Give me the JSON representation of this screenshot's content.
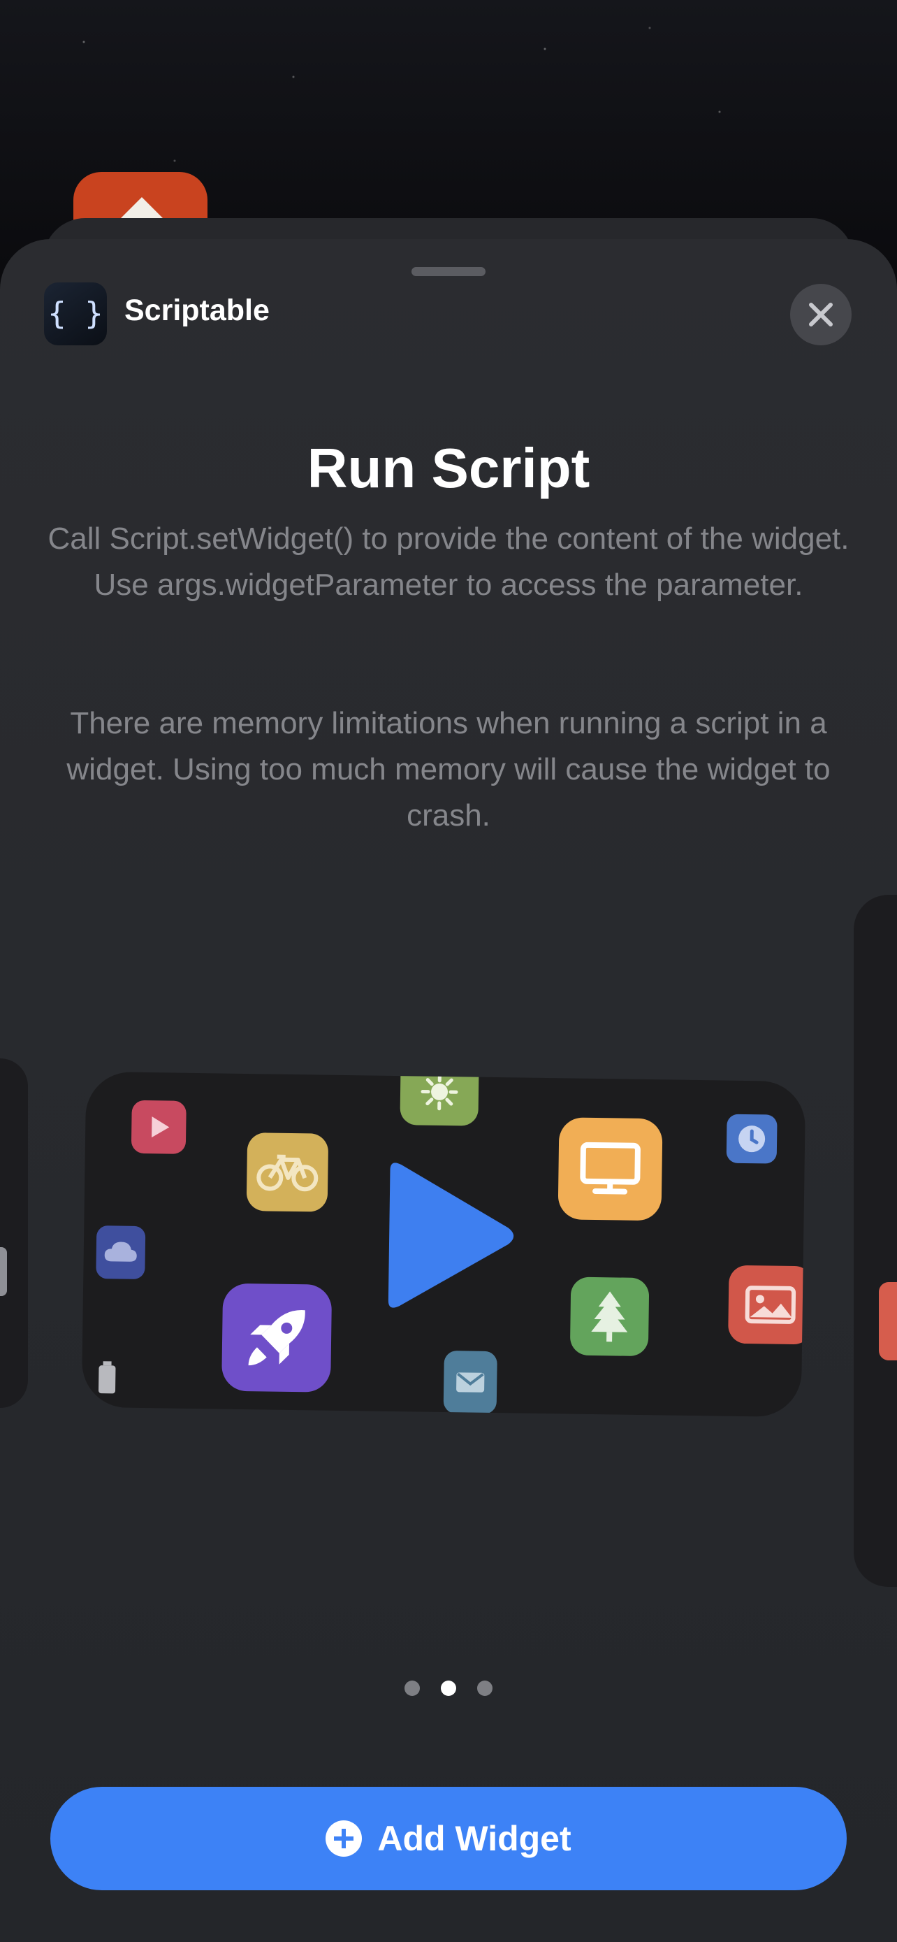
{
  "app": {
    "icon_glyph": "{ }",
    "name": "Scriptable"
  },
  "widget": {
    "title": "Run Script",
    "description_1": "Call Script.setWidget() to provide the content of the widget. Use args.widgetParameter to access the parameter.",
    "description_2": "There are memory limitations when running a script in a widget. Using too much memory will cause the widget to crash."
  },
  "preview_icons": [
    {
      "name": "play-small-icon",
      "color": "#c84a60"
    },
    {
      "name": "bicycle-icon",
      "color": "#d3b15a"
    },
    {
      "name": "sun-icon",
      "color": "#86a856"
    },
    {
      "name": "play-large-icon",
      "color": "#3e7ff0"
    },
    {
      "name": "monitor-icon",
      "color": "#f1ae55"
    },
    {
      "name": "clock-icon",
      "color": "#4a76c8"
    },
    {
      "name": "cloud-icon",
      "color": "#3f4f9e"
    },
    {
      "name": "rocket-icon",
      "color": "#6f4fc9"
    },
    {
      "name": "tree-icon",
      "color": "#63a45c"
    },
    {
      "name": "image-icon",
      "color": "#d1574a"
    },
    {
      "name": "mail-icon",
      "color": "#4f7d9a"
    },
    {
      "name": "battery-icon",
      "color": "#8f9096"
    }
  ],
  "pagination": {
    "count": 3,
    "active_index": 1
  },
  "primary_action": {
    "label": "Add Widget"
  },
  "colors": {
    "accent": "#3d82f6",
    "sheet": "#2b2c30",
    "widget_bg": "#1c1c1e"
  }
}
